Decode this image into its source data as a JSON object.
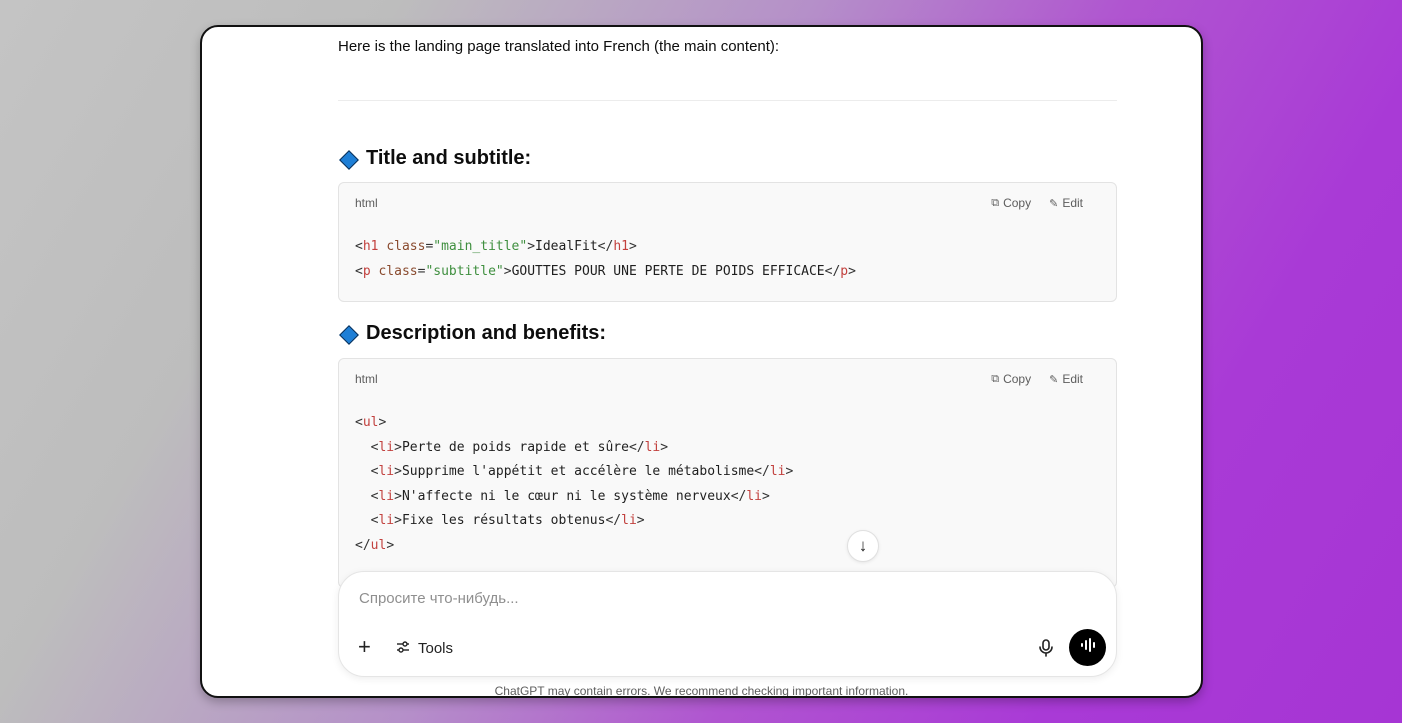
{
  "chat": {
    "intro": "Here is the landing page translated into French (the main content):",
    "sections": [
      {
        "heading": "Title and subtitle:",
        "code_lang": "html",
        "copy_label": "Copy",
        "edit_label": "Edit"
      },
      {
        "heading": "Description and benefits:",
        "code_lang": "html",
        "copy_label": "Copy",
        "edit_label": "Edit"
      }
    ],
    "code1": {
      "line1": {
        "open_tag": "h1",
        "attr": "class",
        "value": "\"main_title\"",
        "text": "IdealFit",
        "close_tag": "h1"
      },
      "line2": {
        "open_tag": "p",
        "attr": "class",
        "value": "\"subtitle\"",
        "text": "GOUTTES POUR UNE PERTE DE POIDS EFFICACE",
        "close_tag": "p"
      }
    },
    "code2": {
      "list_tag": "ul",
      "item_tag": "li",
      "items": [
        "Perte de poids rapide et sûre",
        "Supprime l'appétit et accélère le métabolisme",
        "N'affecte ni le cœur ni le système nerveux",
        "Fixe les résultats obtenus"
      ]
    }
  },
  "composer": {
    "placeholder": "Спросите что-нибудь...",
    "tools_label": "Tools"
  },
  "footer": {
    "disclaimer": "ChatGPT may contain errors. We recommend checking important information."
  },
  "icons": {
    "plus": "plus-icon",
    "tools": "sliders-icon",
    "mic": "microphone-icon",
    "voice": "voice-mode-icon",
    "copy": "copy-icon",
    "edit": "pencil-icon",
    "scroll": "arrow-down-icon",
    "bullet": "blue-diamond-icon"
  },
  "colors": {
    "diamond": "#1e7fd6",
    "tag": "#c2413e",
    "string": "#3f8f3f",
    "voice_button": "#000000"
  }
}
